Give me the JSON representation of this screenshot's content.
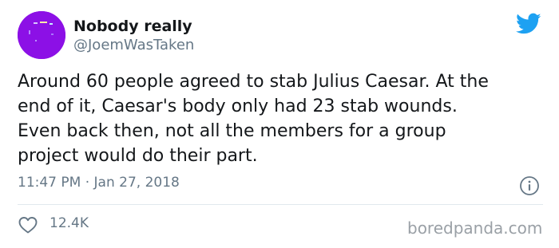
{
  "author": {
    "display_name": "Nobody really",
    "handle": "@JoemWasTaken",
    "avatar_color": "#8c10e6"
  },
  "tweet": {
    "text_lines": [
      "Around 60 people agreed to stab Julius Caesar. At the",
      "end of it, Caesar's body only had 23 stab wounds.",
      "Even back then, not all the members for a group",
      "project would do their part."
    ],
    "timestamp": "11:47 PM · Jan 27, 2018"
  },
  "actions": {
    "like_count": "12.4K"
  },
  "icons": {
    "brand": "twitter-bird-icon",
    "info": "info-icon",
    "like": "heart-icon"
  },
  "colors": {
    "twitter_blue": "#1da1f2",
    "secondary_text": "#657786",
    "divider": "#e1e8ed"
  },
  "watermark": "boredpanda.com"
}
